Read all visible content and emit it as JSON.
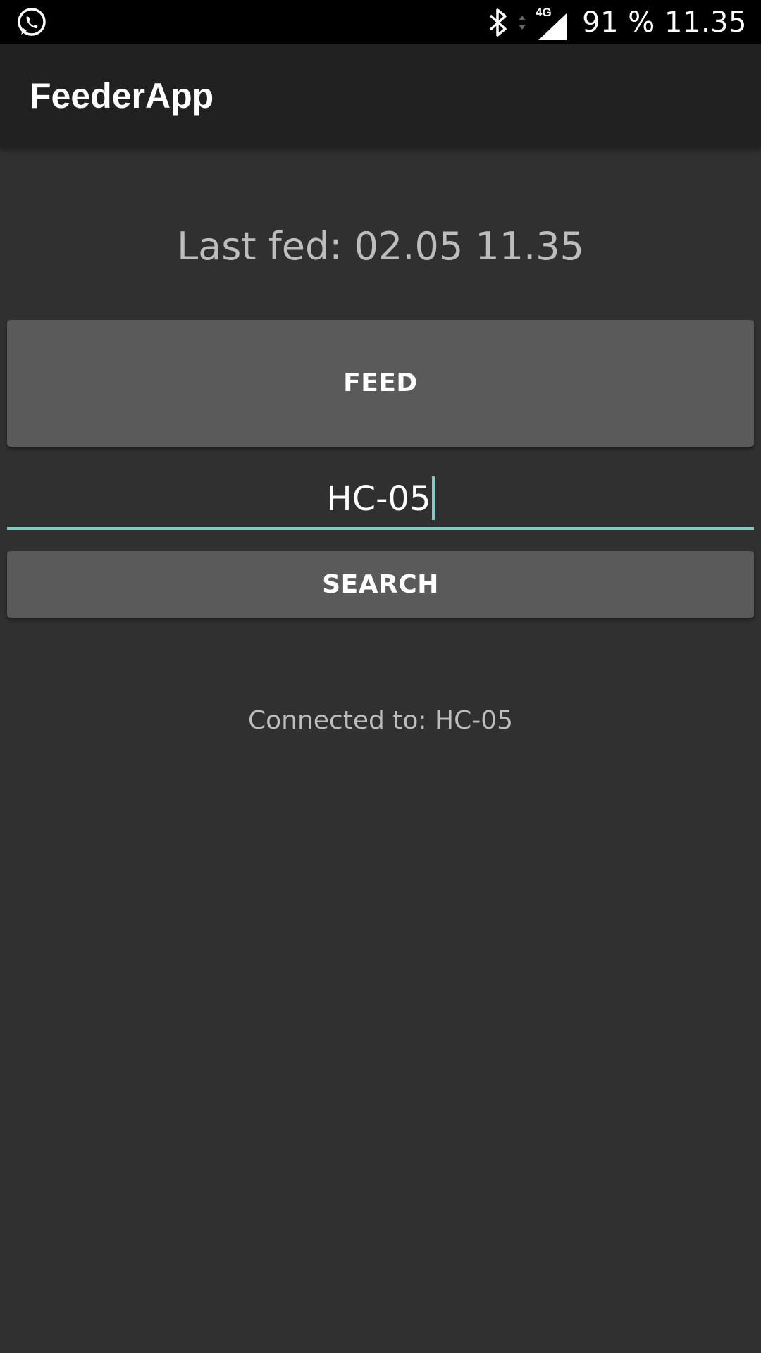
{
  "status_bar": {
    "left_icon": "whatsapp-icon",
    "icons": [
      "bluetooth-icon",
      "data-activity-icon",
      "signal-icon"
    ],
    "network_type": "4G",
    "battery_and_time": "91 % 11.35"
  },
  "app_bar": {
    "title": "FeederApp"
  },
  "main": {
    "last_fed": "Last fed: 02.05 11.35",
    "feed_button_label": "FEED",
    "device_input_value": "HC-05",
    "search_button_label": "SEARCH",
    "connection_status": "Connected to: HC-05"
  },
  "colors": {
    "background": "#303030",
    "app_bar": "#212121",
    "status_bar": "#000000",
    "button": "#5a5a5b",
    "accent": "#80cbc4",
    "secondary_text": "#bdbdbd"
  }
}
